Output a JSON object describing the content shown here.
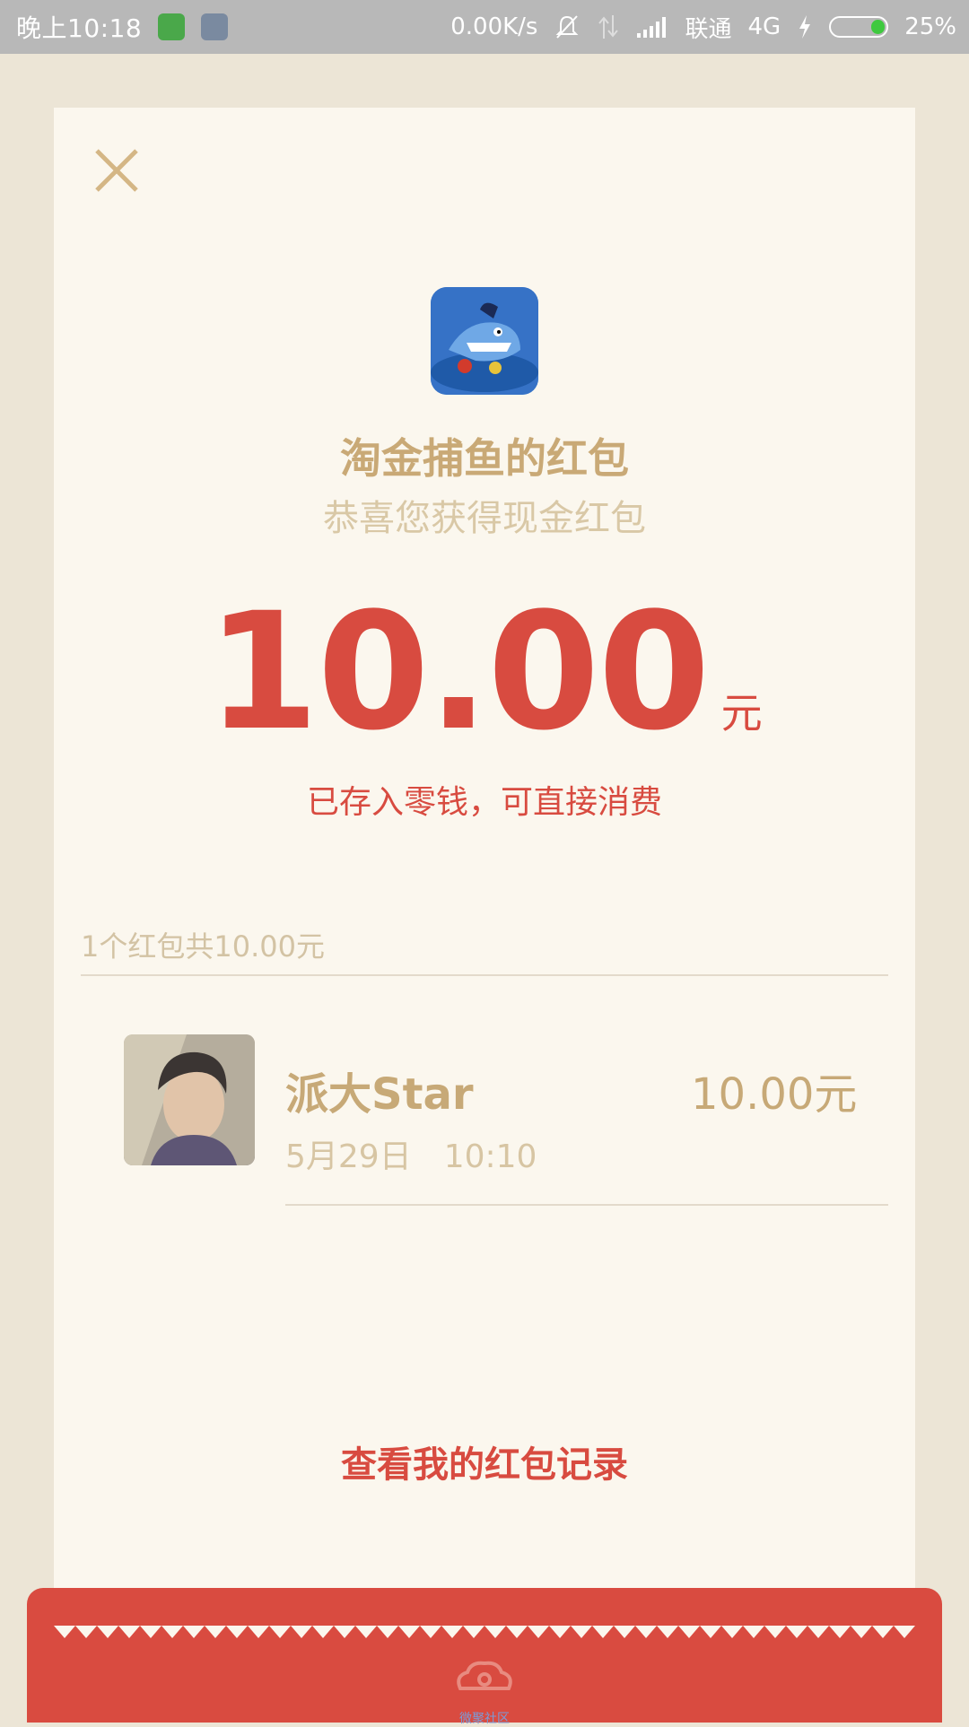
{
  "status_bar": {
    "time": "晚上10:18",
    "speed": "0.00K/s",
    "carrier": "联通",
    "network": "4G",
    "battery_pct": "25%",
    "battery_level": 0.25
  },
  "card": {
    "title": "淘金捕鱼的红包",
    "subtitle": "恭喜您获得现金红包",
    "amount": "10.00",
    "amount_unit": "元",
    "saved_note": "已存入零钱，可直接消费",
    "summary": "1个红包共10.00元",
    "record": {
      "name": "派大Star",
      "amount": "10.00元",
      "date": "5月29日",
      "time": "10:10"
    },
    "view_records": "查看我的红包记录"
  },
  "footer": {
    "text": "微聚社区"
  },
  "colors": {
    "accent_red": "#d84b40",
    "gold": "#c9a976",
    "card_bg": "#fbf7ee",
    "page_bg": "#ece5d6"
  }
}
